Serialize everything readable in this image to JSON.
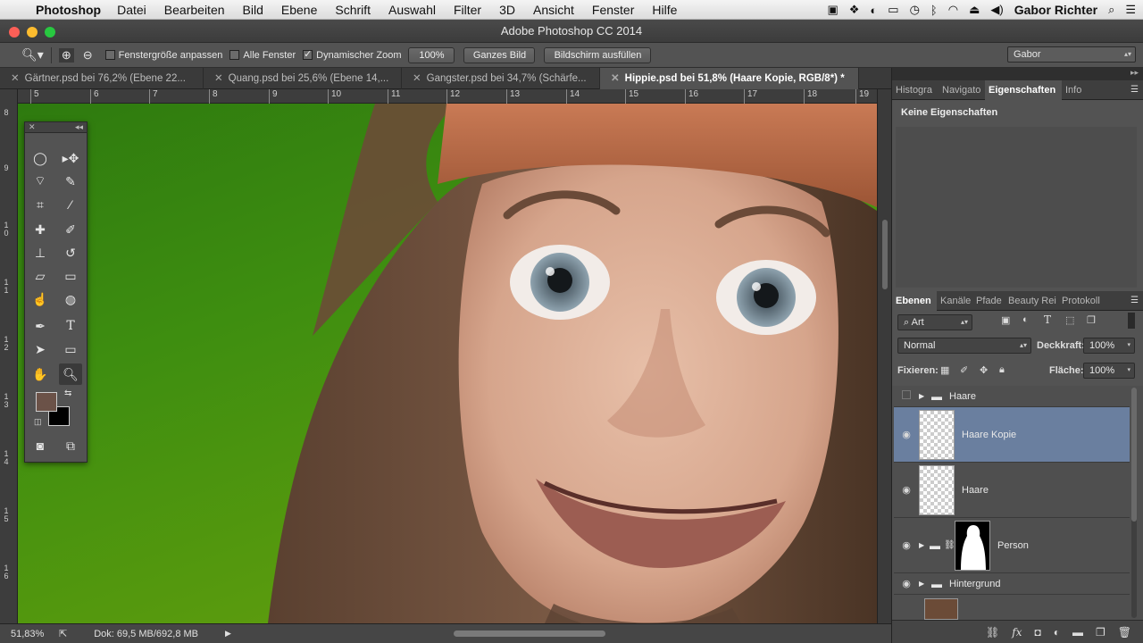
{
  "menubar": {
    "app": "Photoshop",
    "menus": [
      "Datei",
      "Bearbeiten",
      "Bild",
      "Ebene",
      "Schrift",
      "Auswahl",
      "Filter",
      "3D",
      "Ansicht",
      "Fenster",
      "Hilfe"
    ],
    "user": "Gabor Richter"
  },
  "window": {
    "title": "Adobe Photoshop CC 2014"
  },
  "options": {
    "fit_window": "Fenstergröße anpassen",
    "all_windows": "Alle Fenster",
    "dynamic_zoom": "Dynamischer Zoom",
    "zoom_100": "100%",
    "whole_image": "Ganzes Bild",
    "fill_screen": "Bildschirm ausfüllen",
    "workspace": "Gabor"
  },
  "tabs": [
    {
      "label": "Gärtner.psd bei 76,2% (Ebene 22..."
    },
    {
      "label": "Quang.psd bei 25,6% (Ebene 14,..."
    },
    {
      "label": "Gangster.psd bei 34,7% (Schärfe..."
    },
    {
      "label": "Hippie.psd bei 51,8% (Haare Kopie, RGB/8*) *"
    }
  ],
  "ruler": {
    "h": [
      "5",
      "6",
      "7",
      "8",
      "9",
      "10",
      "11",
      "12",
      "13",
      "14",
      "15",
      "16",
      "17",
      "18",
      "19"
    ],
    "v": [
      "8",
      "9",
      "1 0",
      "1 1",
      "1 2",
      "1 3",
      "1 4",
      "1 5",
      "1 6"
    ]
  },
  "status": {
    "zoom": "51,83%",
    "doc": "Dok: 69,5 MB/692,8 MB"
  },
  "props_panel": {
    "tabs": [
      "Histogra",
      "Navigato",
      "Eigenschaften",
      "Info"
    ],
    "message": "Keine Eigenschaften"
  },
  "layers_panel": {
    "tabs": [
      "Ebenen",
      "Kanäle",
      "Pfade",
      "Beauty Rei",
      "Protokoll"
    ],
    "filter": "Art",
    "blend": "Normal",
    "opacity_label": "Deckkraft:",
    "opacity": "100%",
    "lock_label": "Fixieren:",
    "fill_label": "Fläche:",
    "fill": "100%",
    "layers": [
      {
        "name": "Haare",
        "type": "group"
      },
      {
        "name": "Haare Kopie",
        "type": "layer"
      },
      {
        "name": "Haare",
        "type": "layer"
      },
      {
        "name": "Person",
        "type": "group-mask"
      },
      {
        "name": "Hintergrund",
        "type": "group"
      }
    ]
  },
  "colors": {
    "accent_selected_layer": "#6a7f9f",
    "foreground": "#6b5248",
    "background": "#000000"
  }
}
